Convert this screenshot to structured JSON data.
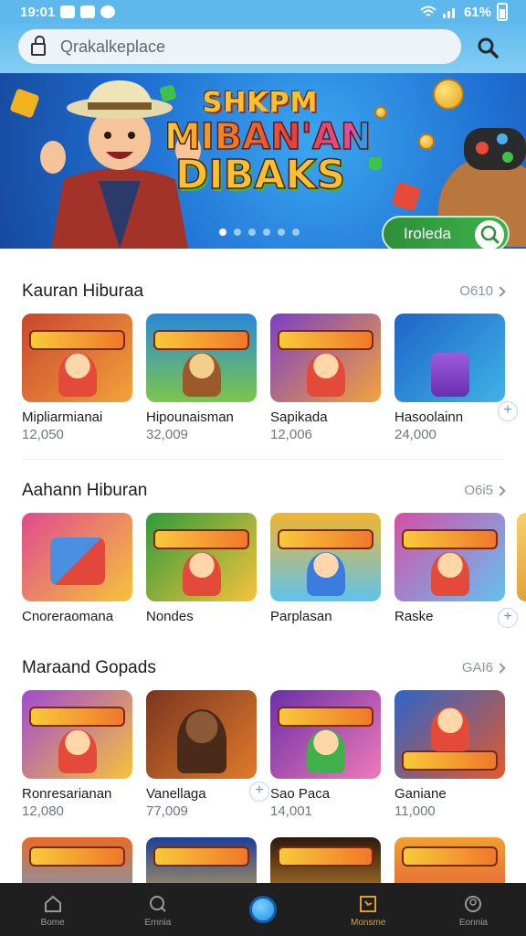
{
  "status_bar": {
    "time": "19:01",
    "battery": "61%"
  },
  "search": {
    "placeholder": "Qrakalkeplace"
  },
  "banner": {
    "title_line1": "SHKPM",
    "title_line2": "MIBAN'AN",
    "title_line3": "DIBAKS",
    "cta_label": "Iroleda",
    "slide_count": 6,
    "active_slide": 0
  },
  "sections": [
    {
      "title": "Kauran Hiburaa",
      "more": "O610",
      "items": [
        {
          "name": "Mipliarmianai",
          "count": "12,050",
          "colors": [
            "#c9462e",
            "#f3a33b"
          ]
        },
        {
          "name": "Hipounaisman",
          "count": "32,009",
          "colors": [
            "#2a88d8",
            "#7cc64a"
          ]
        },
        {
          "name": "Sapikada",
          "count": "12,006",
          "colors": [
            "#7b3fc4",
            "#f3a33b"
          ]
        },
        {
          "name": "Hasoolainn",
          "count": "24,000",
          "colors": [
            "#1e64c8",
            "#3fb3e6"
          ]
        }
      ]
    },
    {
      "title": "Aahann Hiburan",
      "more": "O6i5",
      "items": [
        {
          "name": "Cnoreraomana",
          "count": "",
          "colors": [
            "#e04a8f",
            "#f6c33a"
          ]
        },
        {
          "name": "Nondes",
          "count": "",
          "colors": [
            "#2f9b3b",
            "#f6c33a"
          ]
        },
        {
          "name": "Parplasan",
          "count": "",
          "colors": [
            "#f0b530",
            "#5cc4ef"
          ]
        },
        {
          "name": "Raske",
          "count": "",
          "colors": [
            "#d54fa7",
            "#64c1f0"
          ]
        }
      ]
    },
    {
      "title": "Maraand Gopads",
      "more": "GAI6",
      "items": [
        {
          "name": "Ronresarianan",
          "count": "12,080",
          "colors": [
            "#a04ad1",
            "#f6c33a"
          ]
        },
        {
          "name": "Vanellaga",
          "count": "77,009",
          "colors": [
            "#7a3620",
            "#e07a2a"
          ]
        },
        {
          "name": "Sao Paca",
          "count": "14,001",
          "colors": [
            "#6b2fa8",
            "#f07ab8"
          ]
        },
        {
          "name": "Ganiane",
          "count": "11,000",
          "colors": [
            "#2d64c8",
            "#e25a2e"
          ]
        }
      ]
    },
    {
      "items": [
        {
          "colors": [
            "#e86a2a",
            "#4ab0f0"
          ]
        },
        {
          "colors": [
            "#1e3f9a",
            "#f6c33a"
          ]
        },
        {
          "colors": [
            "#2b1a10",
            "#f0a030"
          ]
        },
        {
          "colors": [
            "#f0a030",
            "#e04a3a"
          ]
        }
      ]
    }
  ],
  "bottom_nav": [
    {
      "label": "Bome",
      "icon": "home-icon"
    },
    {
      "label": "Ernnia",
      "icon": "search-icon"
    },
    {
      "label": "",
      "icon": "center-action-icon"
    },
    {
      "label": "Monsme",
      "icon": "calendar-icon",
      "active": true
    },
    {
      "label": "Eonnia",
      "icon": "profile-icon"
    }
  ]
}
